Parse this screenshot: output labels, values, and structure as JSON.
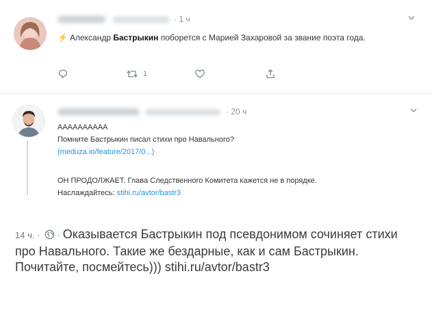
{
  "tweet1": {
    "time": "· 1 ч",
    "text_pre": "Александр ",
    "text_bold": "Бастрыкин",
    "text_post": " поборется с Марией Захаровой за звание поэта года.",
    "retweet_count": "1",
    "icons": [
      "lightning-icon",
      "reply-icon",
      "retweet-icon",
      "like-icon",
      "share-icon",
      "chevron-down-icon"
    ]
  },
  "tweet2": {
    "time": "· 20 ч",
    "line1": "АААААААААА",
    "line2": "Помните Бастрыкин писал стихи про Навального?",
    "line3_link": "(meduza.io/feature/2017/0...)",
    "line4": "ОН ПРОДОЛЖАЕТ. Глава Следственного Комитета кажется не в порядке.",
    "line5_text": "Наслаждайтесь: ",
    "line5_link": "stihi.ru/avtor/bastr3"
  },
  "post": {
    "time": "14 ч. ·",
    "dot": "·",
    "text": "Оказывается Бастрыкин под псевдонимом сочиняет стихи про Навального. Такие же бездарные, как и сам Бастрыкин. Почитайте, посмейтесь))) stihi.ru/avtor/bastr3"
  },
  "colors": {
    "link": "#1b95e0",
    "bolt": "#ffad1f",
    "muted": "#8a9299"
  }
}
